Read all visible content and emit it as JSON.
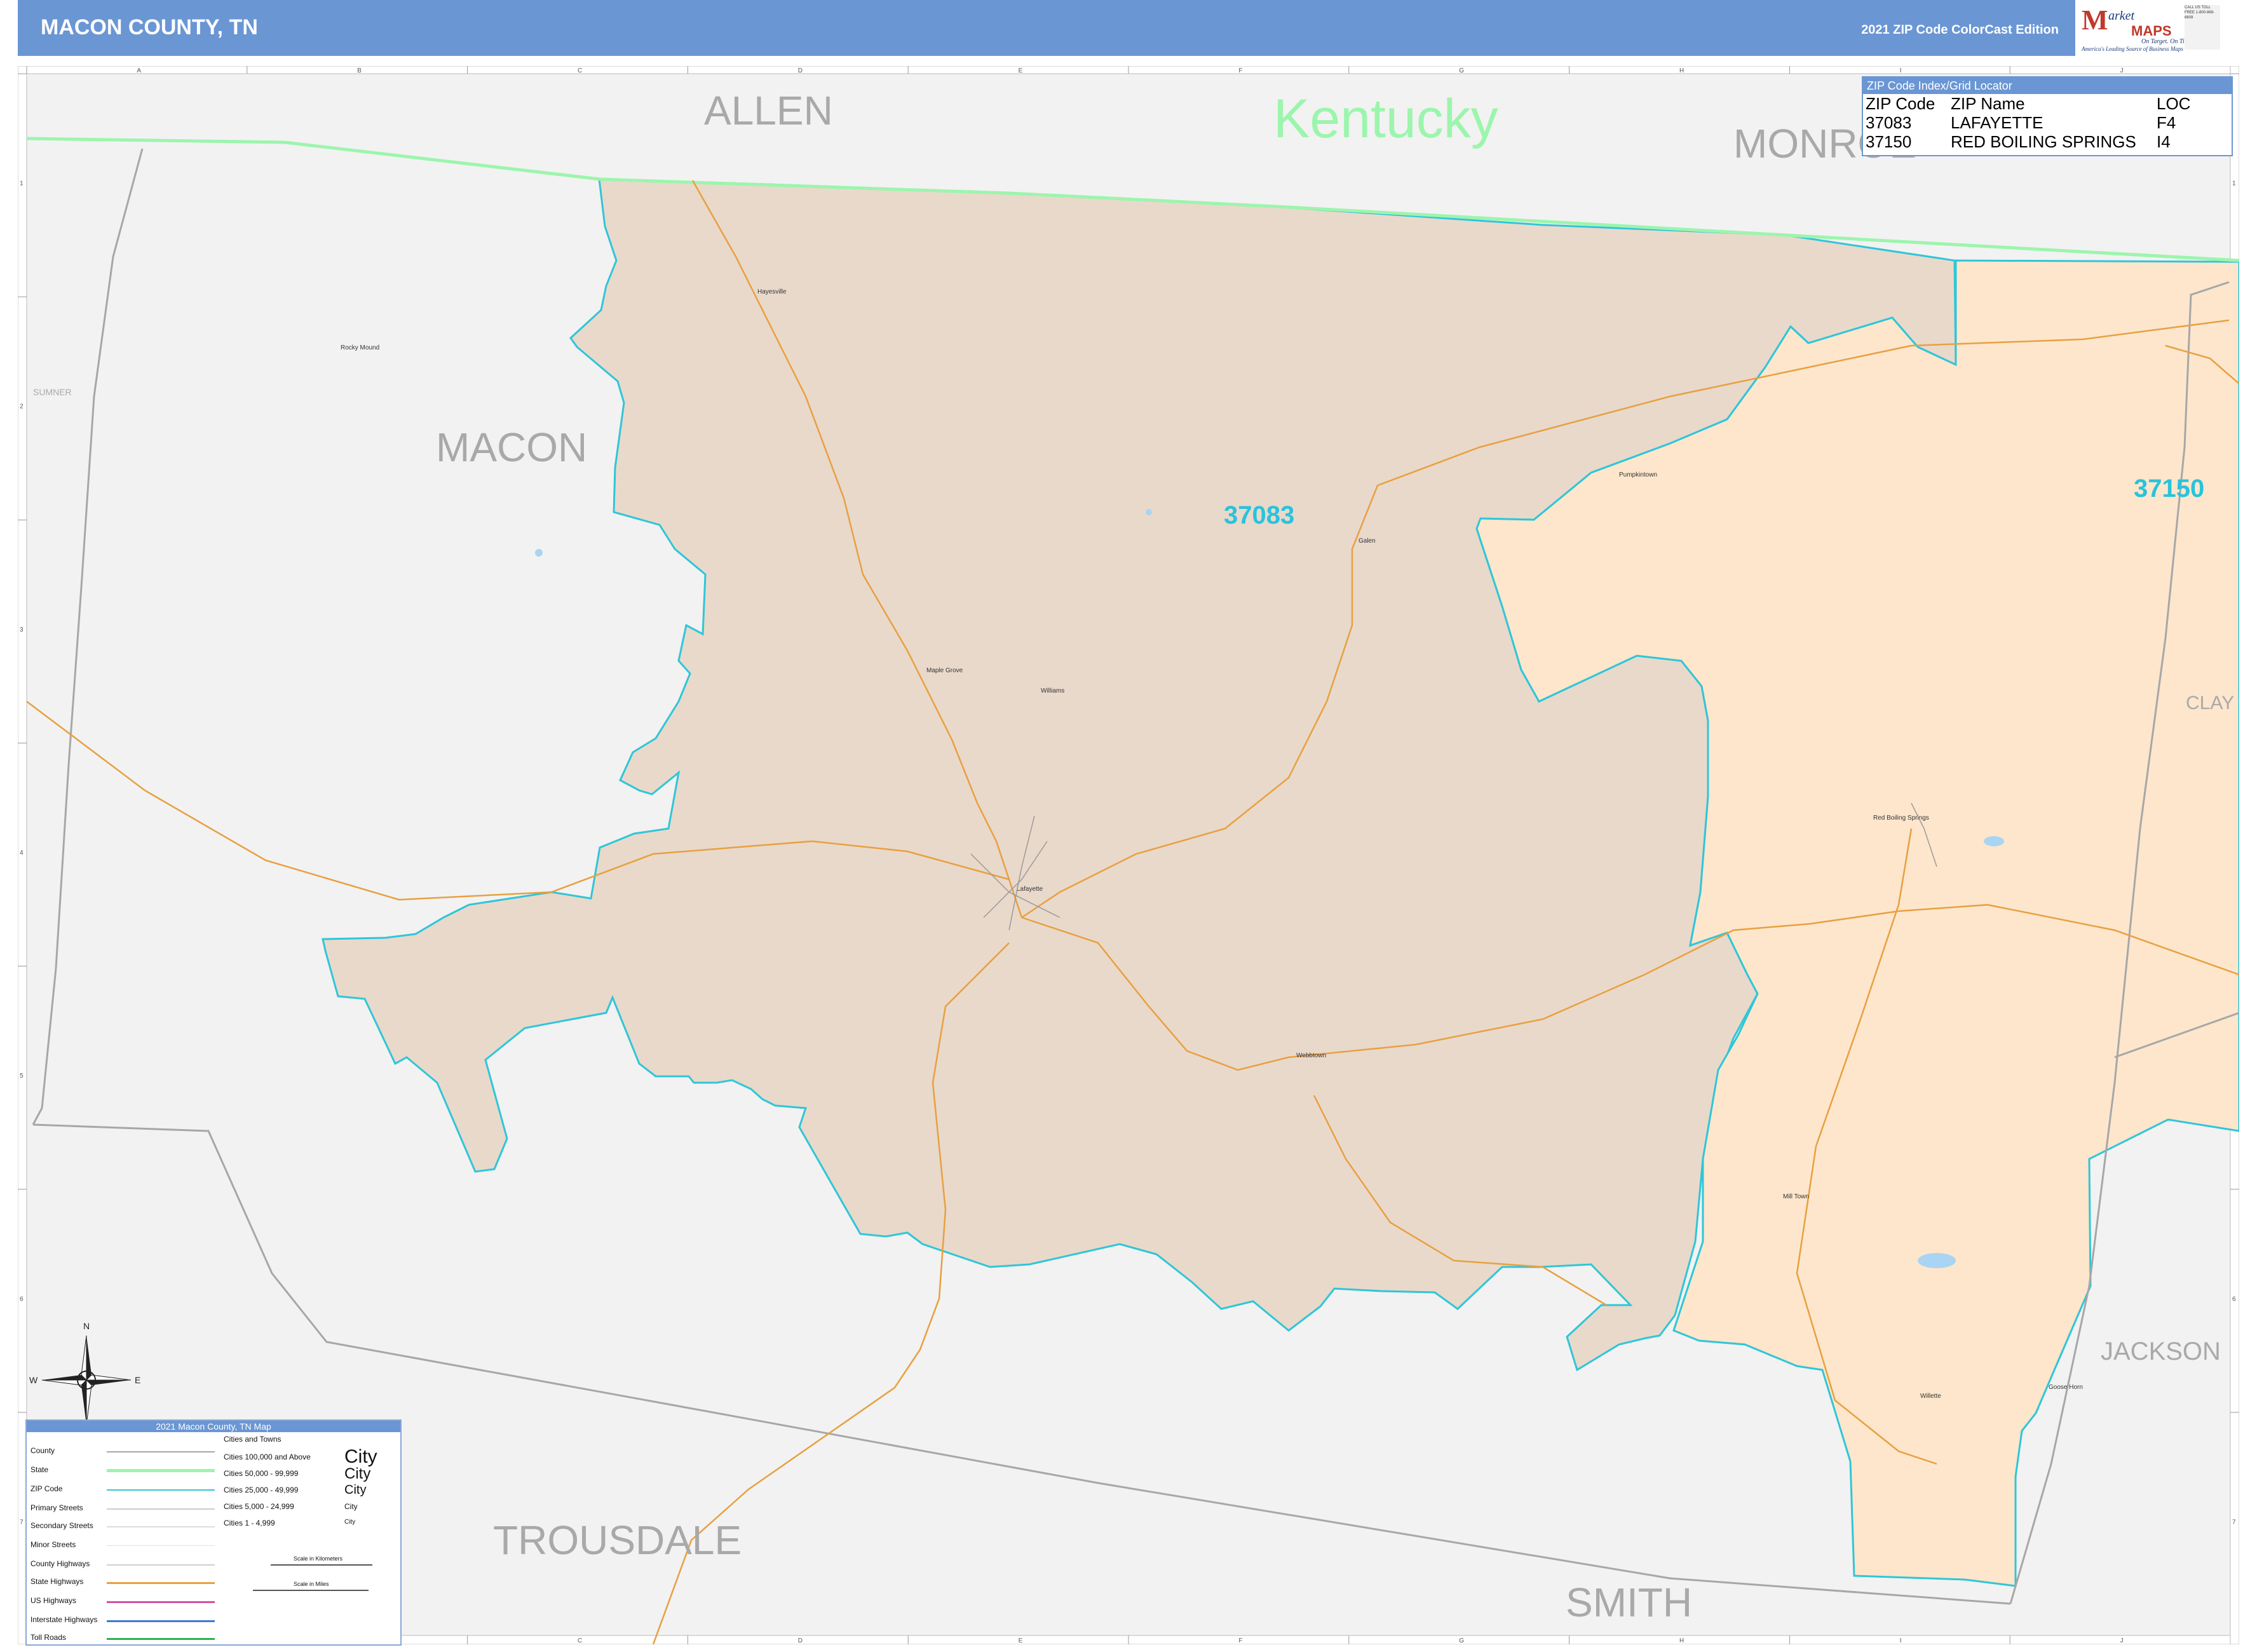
{
  "header": {
    "title": "MACON COUNTY, TN",
    "edition": "2021 ZIP Code ColorCast Edition"
  },
  "logo": {
    "initial": "M",
    "line1": "arket",
    "line2": "MAPS",
    "tagline": "On Target. On Time.",
    "subtitle": "America's Leading Source of Business Maps",
    "contact": "CALL US TOLL FREE 1-800-869-6609"
  },
  "map": {
    "neighbor_labels": {
      "allen": "ALLEN",
      "kentucky": "Kentucky",
      "monroe": "MONROE",
      "macon": "MACON",
      "sumner": "SUMNER",
      "clay": "CLAY",
      "jackson": "JACKSON",
      "trousdale": "TROUSDALE",
      "smith": "SMITH"
    },
    "zip_labels": {
      "z1": "37083",
      "z2": "37150"
    },
    "places": {
      "hayesville": "Hayesville",
      "rocky_mound": "Rocky Mound",
      "pumpkintown": "Pumpkintown",
      "galen": "Galen",
      "maple_grove": "Maple Grove",
      "williams": "Williams",
      "lafayette": "Lafayette",
      "red_boiling_springs": "Red Boiling Springs",
      "webbtown": "Webbtown",
      "mill_town": "Mill Town",
      "willette": "Willette",
      "goose_horn": "Goose Horn"
    },
    "grid_columns": [
      "A",
      "B",
      "C",
      "D",
      "E",
      "F",
      "G",
      "H",
      "I",
      "J"
    ],
    "grid_rows": [
      "1",
      "2",
      "3",
      "4",
      "5",
      "6",
      "7"
    ],
    "compass": {
      "n": "N",
      "s": "S",
      "e": "E",
      "w": "W"
    },
    "colors": {
      "zip_37083_fill": "#e9d9cb",
      "zip_37150_fill": "#fde6cc",
      "outside_fill": "#f2f2f2",
      "zip_boundary": "#2fc6d8",
      "state_boundary": "#9cf5ad",
      "county_boundary": "#a7a7a7",
      "highway": "#e8a040"
    }
  },
  "zip_index": {
    "title": "ZIP Code Index/Grid Locator",
    "columns": [
      "ZIP Code",
      "ZIP Name",
      "LOC"
    ],
    "rows": [
      [
        "37083",
        "LAFAYETTE",
        "F4"
      ],
      [
        "37150",
        "RED BOILING SPRINGS",
        "I4"
      ]
    ]
  },
  "legend": {
    "title": "2021 Macon County, TN Map",
    "line_items": [
      "County",
      "State",
      "ZIP Code",
      "Primary Streets",
      "Secondary Streets",
      "Minor Streets",
      "County Highways",
      "State Highways",
      "US Highways",
      "Interstate Highways",
      "Toll Roads"
    ],
    "cities_header": "Cities and Towns",
    "city_tiers": [
      "Cities 100,000 and Above",
      "Cities 50,000 - 99,999",
      "Cities 25,000 - 49,999",
      "Cities 5,000 - 24,999",
      "Cities 1 - 4,999"
    ],
    "city_sample": "City",
    "scale_km": "Scale in Kilometers",
    "scale_mi": "Scale in Miles"
  }
}
